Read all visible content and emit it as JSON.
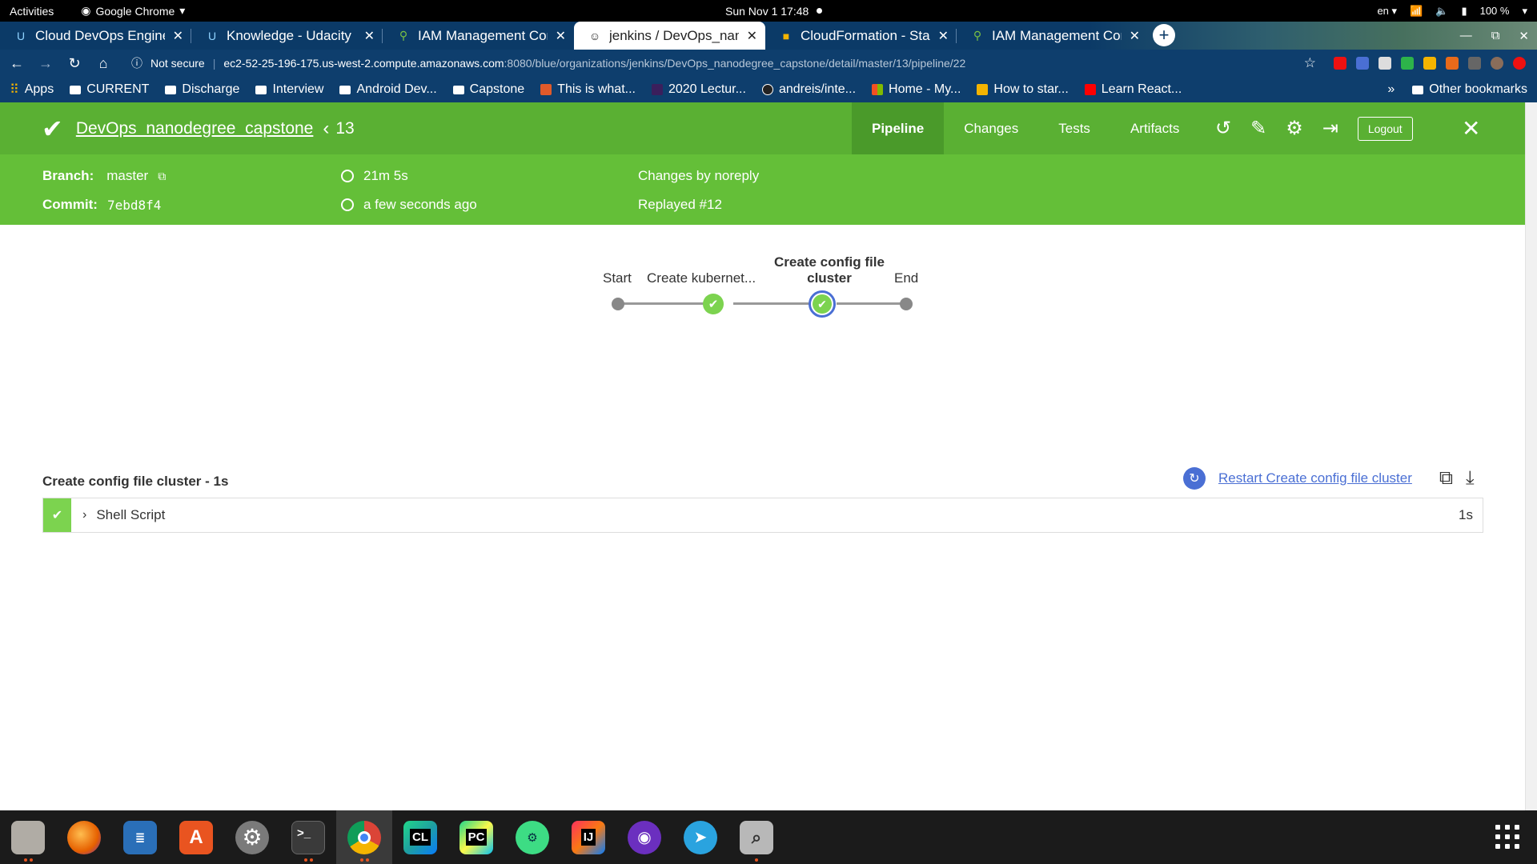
{
  "system": {
    "activities": "Activities",
    "app_name": "Google Chrome",
    "clock": "Sun Nov 1  17:48",
    "lang": "en",
    "battery": "100 %"
  },
  "tabs": [
    {
      "title": "Cloud DevOps Engine",
      "icon": "udacity-icon",
      "active": false
    },
    {
      "title": "Knowledge - Udacity",
      "icon": "udacity-icon",
      "active": false
    },
    {
      "title": "IAM Management Con",
      "icon": "aws-iam-icon",
      "active": false
    },
    {
      "title": "jenkins / DevOps_nanc",
      "icon": "jenkins-icon",
      "active": true
    },
    {
      "title": "CloudFormation - Stac",
      "icon": "aws-cloudformation-icon",
      "active": false
    },
    {
      "title": "IAM Management Con",
      "icon": "aws-iam-icon",
      "active": false
    }
  ],
  "address": {
    "security": "Not secure",
    "host": "ec2-52-25-196-175.us-west-2.compute.amazonaws.com",
    "path": ":8080/blue/organizations/jenkins/DevOps_nanodegree_capstone/detail/master/13/pipeline/22"
  },
  "bookmarks": {
    "items": [
      {
        "label": "Apps",
        "type": "apps"
      },
      {
        "label": "CURRENT",
        "type": "folder"
      },
      {
        "label": "Discharge",
        "type": "folder"
      },
      {
        "label": "Interview",
        "type": "folder"
      },
      {
        "label": "Android Dev...",
        "type": "folder"
      },
      {
        "label": "Capstone",
        "type": "folder"
      },
      {
        "label": "This is what...",
        "type": "site",
        "color": "#e05a2a"
      },
      {
        "label": "2020 Lectur...",
        "type": "site",
        "color": "#3a1f5c"
      },
      {
        "label": "andreis/inte...",
        "type": "site",
        "color": "#222222"
      },
      {
        "label": "Home - My...",
        "type": "site",
        "color": "#f25022"
      },
      {
        "label": "How to star...",
        "type": "site",
        "color": "#f4b400"
      },
      {
        "label": "Learn React...",
        "type": "site",
        "color": "#ff0000"
      }
    ],
    "overflow": "»",
    "other": "Other bookmarks"
  },
  "jenkins": {
    "pipeline_name": "DevOps_nanodegree_capstone",
    "run_number": "13",
    "nav_tabs": [
      "Pipeline",
      "Changes",
      "Tests",
      "Artifacts"
    ],
    "logout": "Logout",
    "summary": {
      "branch_label": "Branch:",
      "branch": "master",
      "commit_label": "Commit:",
      "commit": "7ebd8f4",
      "duration": "21m 5s",
      "time_ago": "a few seconds ago",
      "changes": "Changes by noreply",
      "replayed": "Replayed #12"
    },
    "graph": {
      "start": "Start",
      "stage1": "Create kubernet...",
      "stage2_line1": "Create config file",
      "stage2_line2": "cluster",
      "end": "End"
    },
    "step": {
      "heading": "Create config file cluster - 1s",
      "restart": "Restart Create config file cluster",
      "row_name": "Shell Script",
      "row_duration": "1s"
    }
  },
  "colors": {
    "header_green": "#5ab033",
    "summary_green": "#64bf38",
    "success": "#7cd34f",
    "selected_ring": "#4a6fd4"
  },
  "dock": [
    {
      "name": "files",
      "label": "",
      "color": "#b0aca5",
      "running": 2
    },
    {
      "name": "firefox",
      "label": "",
      "color": "#e66000",
      "running": 0
    },
    {
      "name": "text-editor",
      "label": "",
      "color": "#2a6fb8",
      "running": 0
    },
    {
      "name": "software-center",
      "label": "A",
      "color": "#e95420",
      "running": 0
    },
    {
      "name": "settings",
      "label": "⚙",
      "color": "#7a7a7a",
      "running": 0
    },
    {
      "name": "terminal",
      "label": ">_",
      "color": "#3a3a3a",
      "running": 2
    },
    {
      "name": "chrome",
      "label": "",
      "color": "#ffffff",
      "running": 2
    },
    {
      "name": "clion",
      "label": "CL",
      "color": "#1fa0a0",
      "running": 0
    },
    {
      "name": "pycharm",
      "label": "PC",
      "color": "#111111",
      "running": 0
    },
    {
      "name": "android-studio",
      "label": "",
      "color": "#3ddc84",
      "running": 0
    },
    {
      "name": "intellij",
      "label": "IJ",
      "color": "#1a1a1a",
      "running": 0
    },
    {
      "name": "podcasts",
      "label": "",
      "color": "#6b2fbf",
      "running": 0
    },
    {
      "name": "telegram",
      "label": "",
      "color": "#2aa3df",
      "running": 0
    },
    {
      "name": "screenshot",
      "label": "",
      "color": "#b8b8b8",
      "running": 1
    }
  ]
}
